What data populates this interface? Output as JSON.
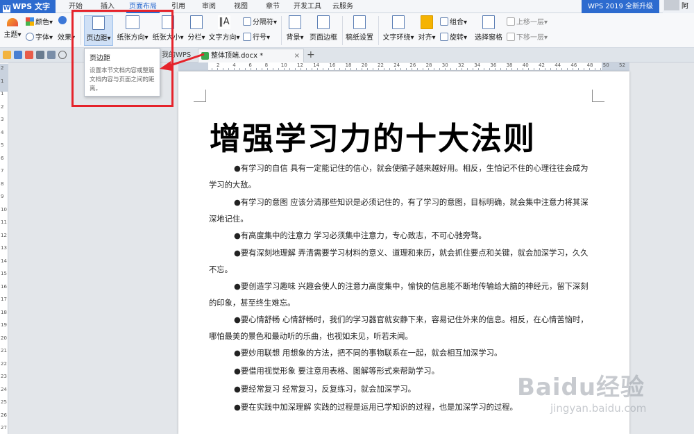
{
  "app": {
    "name": "WPS 文字",
    "upgrade": "WPS 2019 全新升级",
    "user": "阿姨"
  },
  "menu": [
    "开始",
    "插入",
    "页面布局",
    "引用",
    "审阅",
    "视图",
    "章节",
    "开发工具",
    "云服务"
  ],
  "menu_active_index": 2,
  "ribbon": {
    "theme": "主题",
    "colors": "颜色",
    "fonts": "字体",
    "effects": "效果",
    "margins": "页边距",
    "orientation": "纸张方向",
    "size": "纸张大小",
    "columns": "分栏",
    "text_direction": "文字方向",
    "breaks": "分隔符",
    "line_numbers": "行号",
    "background": "背景",
    "page_border": "页面边框",
    "paper_setup": "稿纸设置",
    "wrap_text": "文字环绕",
    "align": "对齐",
    "rotate": "旋转",
    "group": "组合",
    "selection_pane": "选择窗格",
    "bring_forward": "上移一层",
    "send_backward": "下移一层"
  },
  "tabs": [
    {
      "label": "我的WPS"
    },
    {
      "label": "整体顶端.docx *"
    }
  ],
  "tooltip": {
    "title": "页边距",
    "body": "设置本节文档内容或整篇文档内容与页面之间的距离。"
  },
  "ruler_numbers": [
    "2",
    "4",
    "6",
    "8",
    "10",
    "12",
    "14",
    "16",
    "18",
    "20",
    "22",
    "24",
    "26",
    "28",
    "30",
    "32",
    "34",
    "36",
    "38",
    "40",
    "42",
    "44",
    "46",
    "48",
    "50",
    "52"
  ],
  "vruler_numbers": [
    "2",
    "1",
    "1",
    "2",
    "3",
    "4",
    "5",
    "6",
    "7",
    "8",
    "9",
    "10",
    "11",
    "12",
    "13",
    "14",
    "15",
    "16",
    "17",
    "18",
    "19",
    "20",
    "21",
    "22",
    "23",
    "24",
    "25",
    "26",
    "27"
  ],
  "document": {
    "title": "增强学习力的十大法则",
    "paragraphs": [
      "●有学习的自信 具有一定能记住的信心，就会使脑子越来越好用。相反，生怕记不住的心理往往会成为学习的大敌。",
      "●有学习的意图 应该分清那些知识是必须记住的，有了学习的意图，目标明确，就会集中注意力将其深深地记住。",
      "●有高度集中的注意力 学习必须集中注意力，专心致志，不可心驰旁骛。",
      "●要有深刻地理解 弄清需要学习材料的意义、道理和来历，就会抓住要点和关键，就会加深学习，久久不忘。",
      "●要创造学习趣味 兴趣会使人的注意力高度集中，愉快的信息能不断地传输给大脑的神经元，留下深刻的印象，甚至终生难忘。",
      "●要心情舒畅 心情舒畅时，我们的学习器官就安静下来，容易记住外来的信息。相反，在心情苦恼时，哪怕最美的景色和最动听的乐曲，也视如未见，听若未闻。",
      "●要妙用联想 用想象的方法，把不同的事物联系在一起，就会相互加深学习。",
      "●要借用视觉形象 要注意用表格、图解等形式来帮助学习。",
      "●要经常复习 经常复习，反复练习，就会加深学习。",
      "●要在实践中加深理解 实践的过程是运用已学知识的过程，也是加深学习的过程。"
    ]
  },
  "watermark": {
    "brand": "Baidu经验",
    "url": "jingyan.baidu.com"
  },
  "colors": {
    "accent": "#2d6bcf",
    "annotation": "#e5232b"
  }
}
